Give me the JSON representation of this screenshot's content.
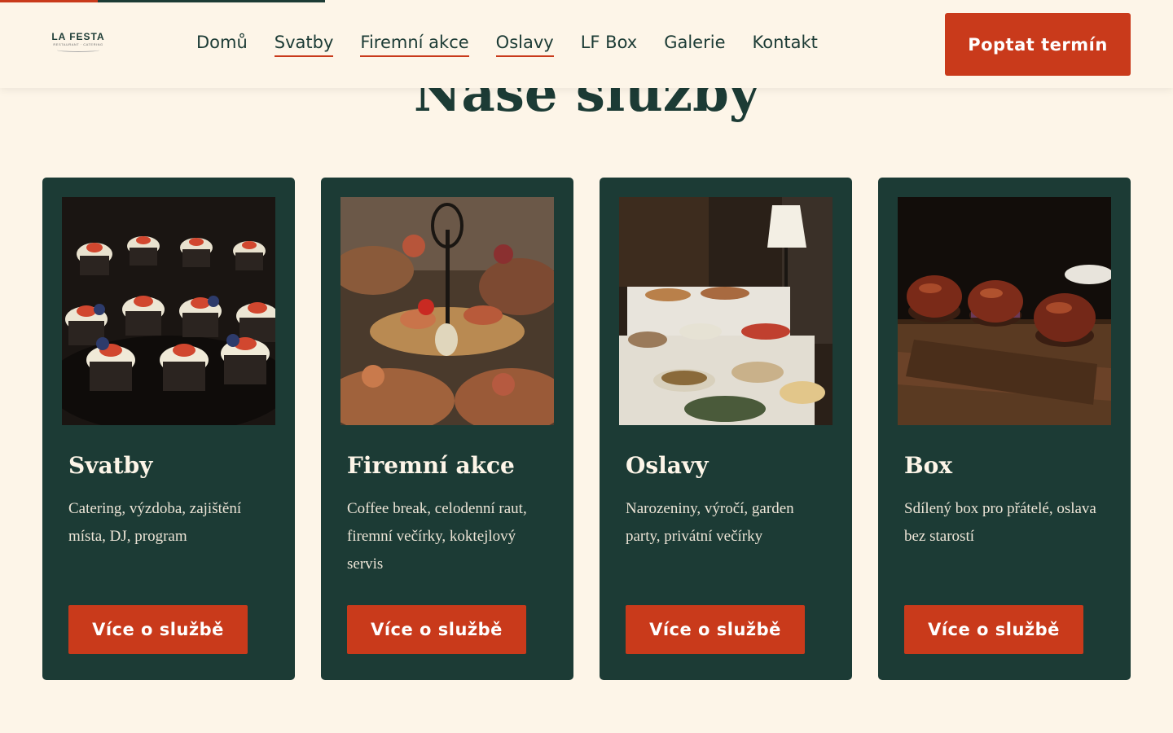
{
  "header": {
    "logo": {
      "name": "LA FESTA",
      "tagline": "RESTAURANT · CATERING"
    },
    "nav": [
      {
        "label": "Domů",
        "underlined": false
      },
      {
        "label": "Svatby",
        "underlined": true
      },
      {
        "label": "Firemní akce",
        "underlined": true
      },
      {
        "label": "Oslavy",
        "underlined": true
      },
      {
        "label": "LF Box",
        "underlined": false
      },
      {
        "label": "Galerie",
        "underlined": false
      },
      {
        "label": "Kontakt",
        "underlined": false
      }
    ],
    "cta_label": "Poptat termín"
  },
  "section": {
    "title": "Naše služby",
    "cards": [
      {
        "title": "Svatby",
        "description": "Catering, výzdoba, zajištění místa, DJ, program",
        "button_label": "Více o službě",
        "image": "cupcakes-photo"
      },
      {
        "title": "Firemní akce",
        "description": "Coffee break, celodenní raut, firemní večírky, koktejlový servis",
        "button_label": "Více o službě",
        "image": "canapes-stand-photo"
      },
      {
        "title": "Oslavy",
        "description": "Narozeniny, výročí, garden party, privátní večírky",
        "button_label": "Více o službě",
        "image": "buffet-table-photo"
      },
      {
        "title": "Box",
        "description": "Sdílený box pro přátelé, oslava bez starostí",
        "button_label": "Více o službě",
        "image": "burgers-board-photo"
      }
    ]
  },
  "colors": {
    "background": "#fdf5e8",
    "brand_green": "#1c3b35",
    "accent_red": "#c93a1b",
    "text_light": "#fdf5e8"
  }
}
